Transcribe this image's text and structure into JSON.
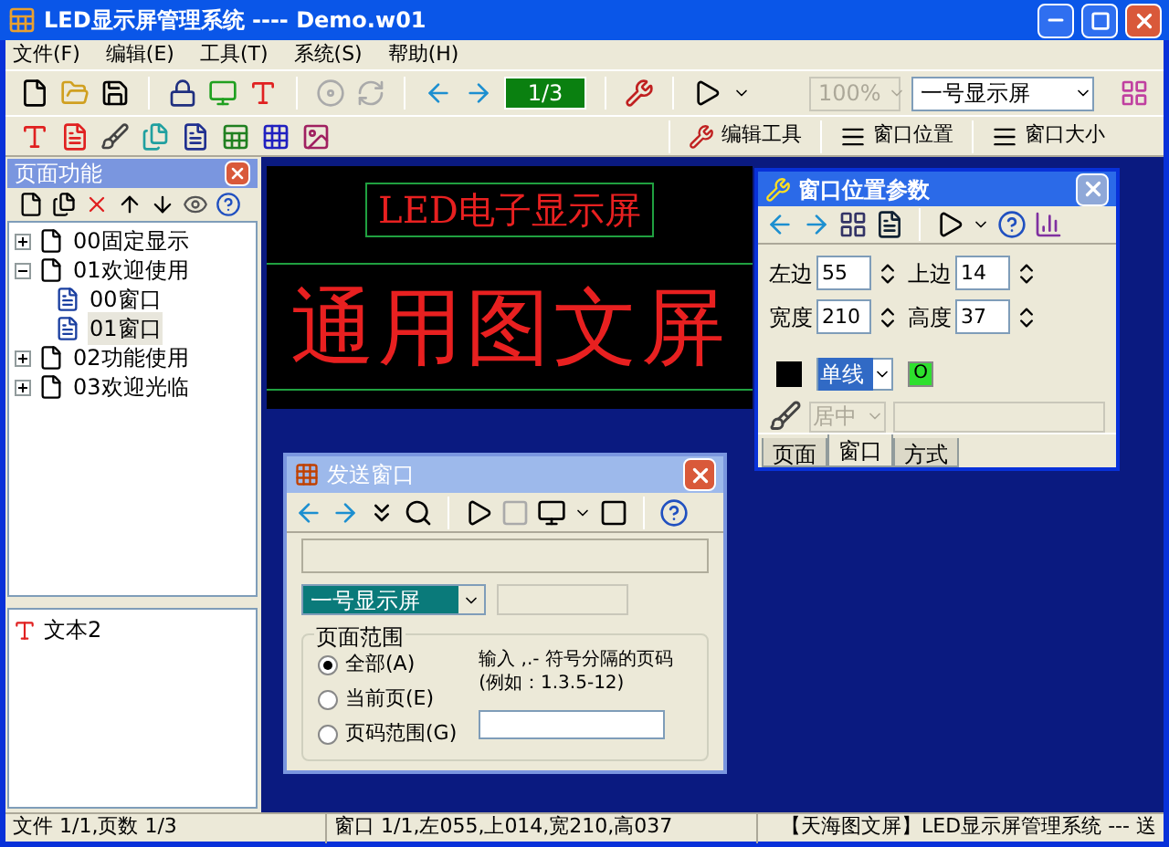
{
  "window": {
    "title": "LED显示屏管理系统 ---- Demo.w01"
  },
  "menu": [
    "文件(F)",
    "编辑(E)",
    "工具(T)",
    "系统(S)",
    "帮助(H)"
  ],
  "toolbar": {
    "page_counter": "1/3",
    "zoom": "100%",
    "display_select": "一号显示屏"
  },
  "toolbar2": [
    "编辑工具",
    "窗口位置",
    "窗口大小"
  ],
  "page_panel": {
    "title": "页面功能",
    "tree": [
      {
        "label": "00固定显示",
        "expanded": false,
        "selected": false
      },
      {
        "label": "01欢迎使用",
        "expanded": true,
        "selected": false,
        "children": [
          {
            "label": "00窗口",
            "selected": false
          },
          {
            "label": "01窗口",
            "selected": true
          }
        ]
      },
      {
        "label": "02功能使用",
        "expanded": false,
        "selected": false
      },
      {
        "label": "03欢迎光临",
        "expanded": false,
        "selected": false
      }
    ]
  },
  "layer_panel": {
    "items": [
      {
        "label": "文本2"
      }
    ]
  },
  "preview": {
    "line1": "LED电子显示屏",
    "line2": "通用图文屏"
  },
  "position_window": {
    "title": "窗口位置参数",
    "fields": [
      {
        "label": "左边",
        "value": "55"
      },
      {
        "label": "上边",
        "value": "14"
      },
      {
        "label": "宽度",
        "value": "210"
      },
      {
        "label": "高度",
        "value": "37"
      }
    ],
    "border_style": "单线",
    "color_button": "O",
    "align": "居中",
    "align_disabled": true,
    "tabs": [
      {
        "label": "页面",
        "selected": false
      },
      {
        "label": "窗口",
        "selected": true
      },
      {
        "label": "方式",
        "selected": false
      }
    ]
  },
  "send_window": {
    "title": "发送窗口",
    "display_select": "一号显示屏",
    "range_title": "页面范围",
    "options": [
      {
        "label": "全部(A)",
        "selected": true
      },
      {
        "label": "当前页(E)",
        "selected": false
      },
      {
        "label": "页码范围(G)",
        "selected": false
      }
    ],
    "hint": "输入 ,.- 符号分隔的页码  (例如：1.3.5-12)"
  },
  "status_bar": [
    "文件 1/1,页数 1/3",
    "窗口 1/1,左055,上014,宽210,高037",
    "【天海图文屏】LED显示屏管理系统 --- 送"
  ]
}
